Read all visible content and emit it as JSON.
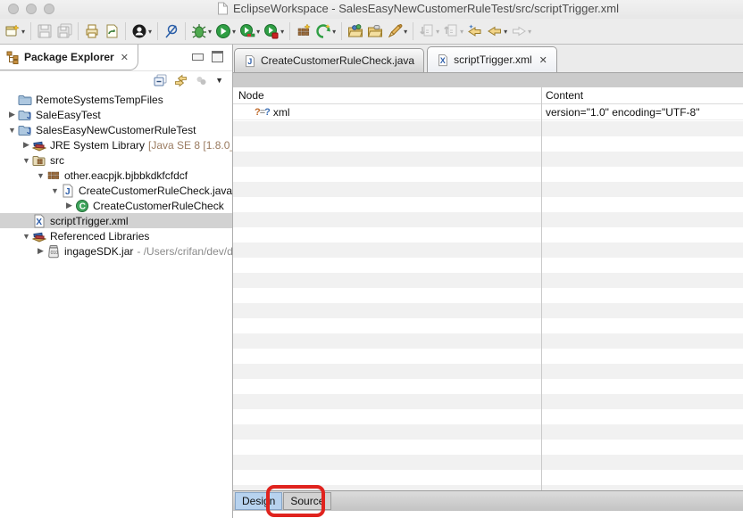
{
  "window": {
    "title": "EclipseWorkspace - SalesEasyNewCustomerRuleTest/src/scriptTrigger.xml"
  },
  "colors": {
    "annotation_red": "#e0231e",
    "selected_tree_row": "#d2d2d2",
    "design_tab_selected": "#b7d2ee"
  },
  "toolbar": {
    "icons": [
      "new-wizard",
      "save",
      "save-all",
      "print",
      "sync",
      "user-account",
      "skip-breakpoints",
      "debug",
      "run",
      "coverage",
      "profile",
      "new-package",
      "green-refresh",
      "open-folder-objects",
      "open-folder",
      "pen",
      "next-annotation",
      "previous-annotation",
      "last-edit-location",
      "back",
      "forward"
    ],
    "dropdown_glyph": "▾"
  },
  "package_explorer": {
    "title": "Package Explorer",
    "close_glyph": "✕",
    "view_toolbar_icons": [
      "collapse-all",
      "link-with-editor",
      "focus",
      "view-menu"
    ],
    "menu_glyph": "▼"
  },
  "tree": {
    "items": [
      {
        "arrow": "",
        "label": "RemoteSystemsTempFiles",
        "dec": ""
      },
      {
        "arrow": "▶",
        "label": "SaleEasyTest",
        "dec": ""
      },
      {
        "arrow": "▼",
        "label": "SalesEasyNewCustomerRuleTest",
        "dec": ""
      },
      {
        "arrow": "▶",
        "label": "JRE System Library",
        "dec": "[Java SE 8 [1.8.0_"
      },
      {
        "arrow": "▼",
        "label": "src",
        "dec": ""
      },
      {
        "arrow": "▼",
        "label": "other.eacpjk.bjbbkdkfcfdcf",
        "dec": ""
      },
      {
        "arrow": "▼",
        "label": "CreateCustomerRuleCheck.java",
        "dec": ""
      },
      {
        "arrow": "▶",
        "label": "CreateCustomerRuleCheck",
        "dec": ""
      },
      {
        "arrow": "",
        "label": "scriptTrigger.xml",
        "dec": "",
        "selected": true
      },
      {
        "arrow": "▼",
        "label": "Referenced Libraries",
        "dec": ""
      },
      {
        "arrow": "▶",
        "label": "ingageSDK.jar",
        "dec": "- /Users/crifan/dev/d"
      }
    ]
  },
  "editor": {
    "tabs": [
      {
        "label": "CreateCustomerRuleCheck.java",
        "active": false
      },
      {
        "label": "scriptTrigger.xml",
        "close_glyph": "✕",
        "active": true
      }
    ],
    "design_view": {
      "columns": {
        "node": "Node",
        "content": "Content"
      },
      "row": {
        "icon": {
          "q1": "?",
          "eq": "=",
          "q2": "?"
        },
        "node": "xml",
        "content": "version=\"1.0\" encoding=\"UTF-8\""
      }
    },
    "bottom_tabs": {
      "design": "Design",
      "source": "Source"
    }
  }
}
